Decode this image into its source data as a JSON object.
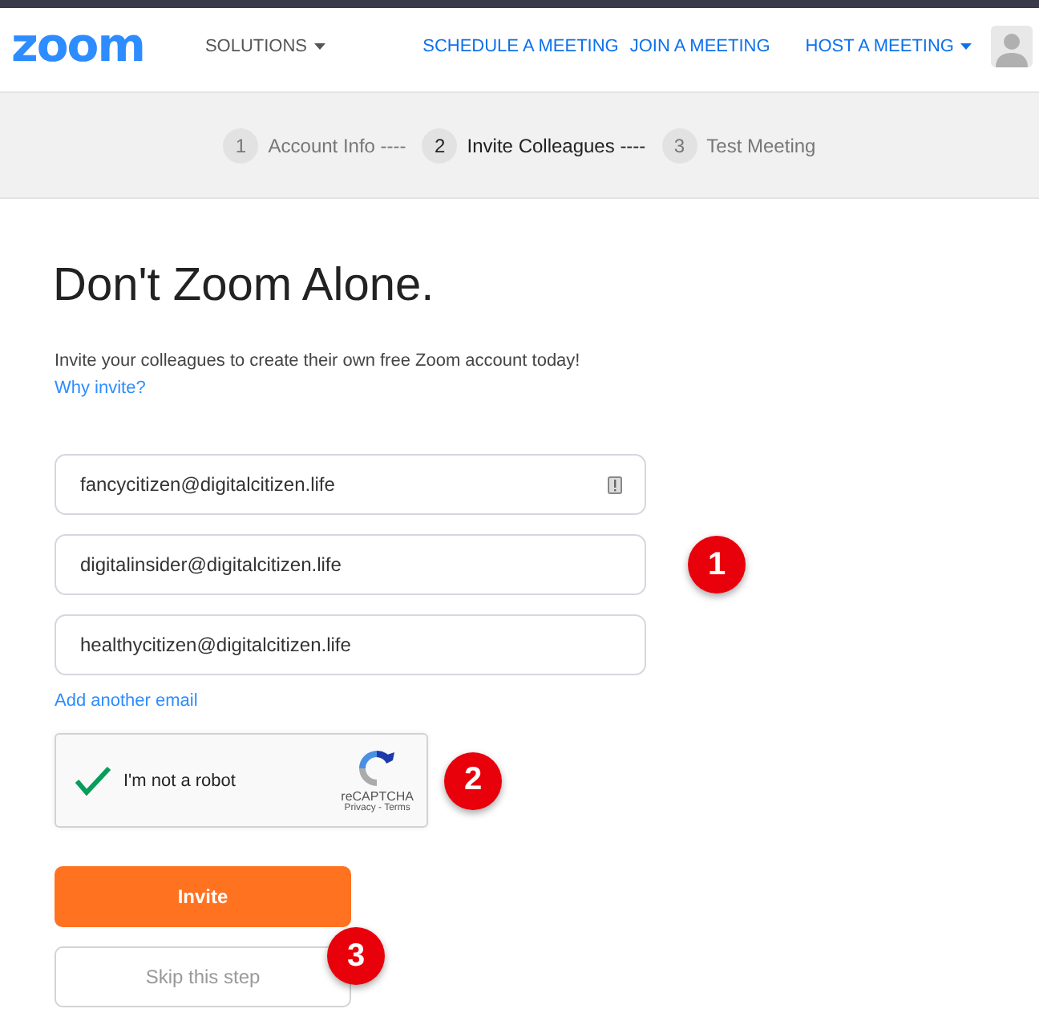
{
  "header": {
    "logo": "zoom",
    "solutions": "SOLUTIONS",
    "links": [
      "SCHEDULE A MEETING",
      "JOIN A MEETING"
    ],
    "host": "HOST A MEETING"
  },
  "steps": [
    {
      "number": "1",
      "label": "Account Info ----",
      "selected": false
    },
    {
      "number": "2",
      "label": "Invite Colleagues ----",
      "selected": true
    },
    {
      "number": "3",
      "label": "Test Meeting",
      "selected": false
    }
  ],
  "title": "Don't Zoom Alone.",
  "intro": "Invite your colleagues to create their own free Zoom account today!",
  "why_link": "Why invite?",
  "emails": [
    {
      "value": "fancycitizen@digitalcitizen.life",
      "autofill_icon": true
    },
    {
      "value": "digitalinsider@digitalcitizen.life",
      "autofill_icon": false
    },
    {
      "value": "healthycitizen@digitalcitizen.life",
      "autofill_icon": false
    }
  ],
  "add_email": "Add another email",
  "captcha": {
    "checked": true,
    "label": "I'm not a robot",
    "brand": "reCAPTCHA",
    "terms": "Privacy - Terms"
  },
  "invite_button": "Invite",
  "skip_button": "Skip this step",
  "callouts": [
    "1",
    "2",
    "3"
  ]
}
